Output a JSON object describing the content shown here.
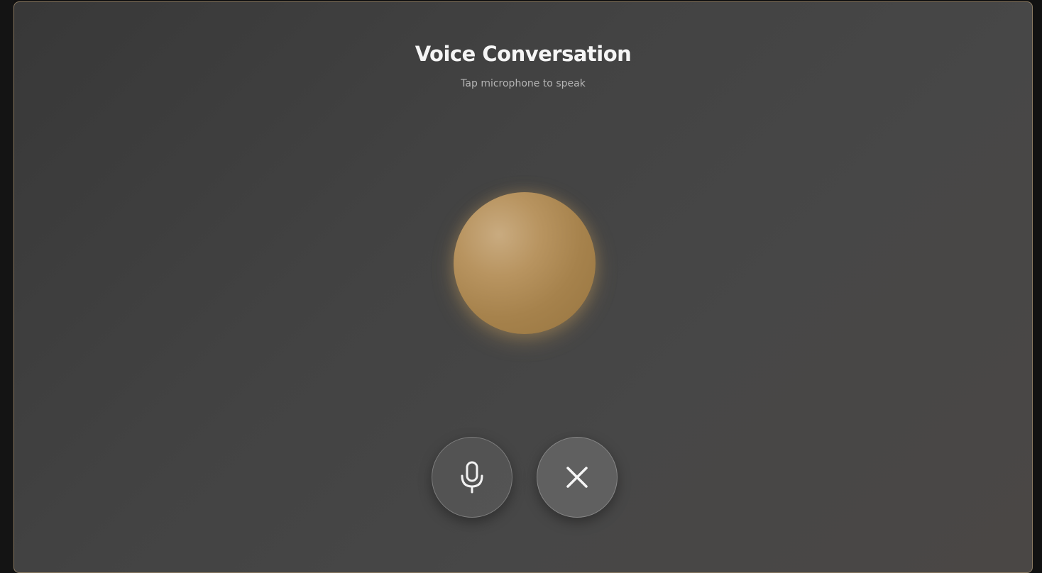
{
  "dialog": {
    "title": "Voice Conversation",
    "subtitle": "Tap microphone to speak"
  },
  "orb": {
    "color": "#a6824c"
  },
  "controls": {
    "mic_icon": "microphone-icon",
    "close_icon": "close-icon"
  },
  "theme": {
    "accent": "#b8945a",
    "background": "#3f3f3f",
    "border": "#8a7a62"
  }
}
